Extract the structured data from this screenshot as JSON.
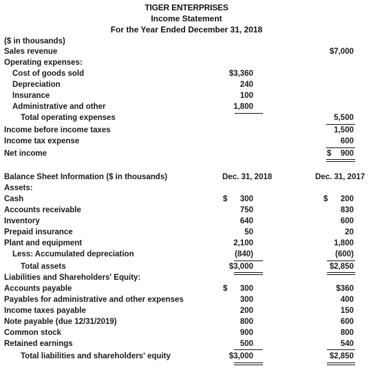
{
  "header": {
    "company": "TIGER ENTERPRISES",
    "statement": "Income Statement",
    "period": "For the Year Ended December 31, 2018"
  },
  "income_statement": {
    "units_note": "($ in thousands)",
    "sales_revenue": {
      "label": "Sales revenue",
      "value": "$7,000"
    },
    "operating_expenses_label": "Operating expenses:",
    "expenses": [
      {
        "label": "Cost of goods sold",
        "value": "$3,360"
      },
      {
        "label": "Depreciation",
        "value": "240"
      },
      {
        "label": "Insurance",
        "value": "100"
      },
      {
        "label": "Administrative and other",
        "value": "1,800"
      }
    ],
    "total_operating_expenses": {
      "label": "Total operating expenses",
      "value": "5,500"
    },
    "income_before_taxes": {
      "label": "Income before income taxes",
      "value": "1,500"
    },
    "income_tax_expense": {
      "label": "Income tax expense",
      "value": "600"
    },
    "net_income": {
      "label": "Net income",
      "symbol": "$",
      "value": "900"
    }
  },
  "balance_sheet": {
    "title": "Balance Sheet Information ($ in thousands)",
    "col_2018": "Dec. 31, 2018",
    "col_2017": "Dec. 31, 2017",
    "assets_label": "Assets:",
    "assets": [
      {
        "label": "Cash",
        "v2018": "$ 300",
        "v2017": "$ 200"
      },
      {
        "label": "Accounts receivable",
        "v2018": "750",
        "v2017": "830"
      },
      {
        "label": "Inventory",
        "v2018": "640",
        "v2017": "600"
      },
      {
        "label": "Prepaid insurance",
        "v2018": "50",
        "v2017": "20"
      },
      {
        "label": "Plant and equipment",
        "v2018": "2,100",
        "v2017": "1,800"
      },
      {
        "label": "Less: Accumulated depreciation",
        "v2018": "(840)",
        "v2017": "(600)"
      }
    ],
    "total_assets": {
      "label": "Total assets",
      "v2018": "$3,000",
      "v2017": "$2,850"
    },
    "liabilities_label": "Liabilities and Shareholders' Equity:",
    "liabilities": [
      {
        "label": "Accounts payable",
        "v2018": "$ 300",
        "v2017": "$360"
      },
      {
        "label": "Payables for administrative and other expenses",
        "v2018": "300",
        "v2017": "400"
      },
      {
        "label": "Income taxes payable",
        "v2018": "200",
        "v2017": "150"
      },
      {
        "label": "Note payable (due 12/31/2019)",
        "v2018": "800",
        "v2017": "600"
      },
      {
        "label": "Common stock",
        "v2018": "900",
        "v2017": "800"
      },
      {
        "label": "Retained earnings",
        "v2018": "500",
        "v2017": "540"
      }
    ],
    "total_liabilities_equity": {
      "label": "Total liabilities and shareholders' equity",
      "v2018": "$3,000",
      "v2017": "$2,850"
    }
  }
}
